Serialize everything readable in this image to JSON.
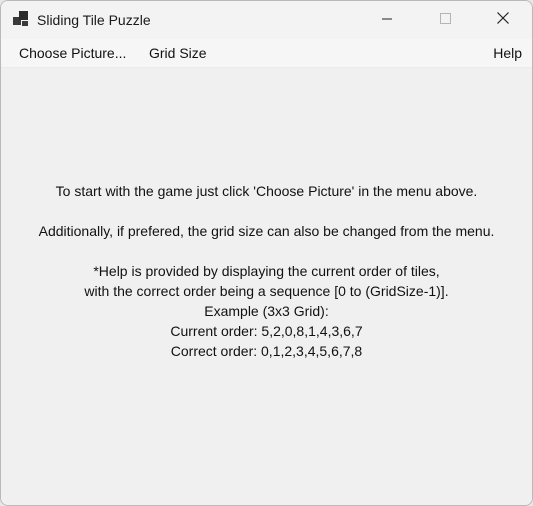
{
  "window": {
    "title": "Sliding Tile Puzzle"
  },
  "menu": {
    "items": [
      {
        "label": "Choose Picture..."
      },
      {
        "label": "Grid Size"
      },
      {
        "label": "Help"
      }
    ]
  },
  "instructions": {
    "lines": [
      "To start with the game just click 'Choose Picture' in the menu above.",
      "",
      "Additionally, if prefered, the grid size can also be changed from the menu.",
      "",
      "*Help is provided by displaying the current order of tiles,",
      "with the correct order being a sequence [0 to (GridSize-1)].",
      "Example (3x3 Grid):",
      "Current order: 5,2,0,8,1,4,3,6,7",
      "Correct order: 0,1,2,3,4,5,6,7,8"
    ]
  },
  "icons": {
    "app": "app-icon",
    "minimize": "minimize-icon",
    "maximize": "maximize-icon",
    "close": "close-icon"
  },
  "colors": {
    "window_bg": "#f0f0f0",
    "titlebar_bg": "#f3f3f3",
    "text": "#111111"
  }
}
